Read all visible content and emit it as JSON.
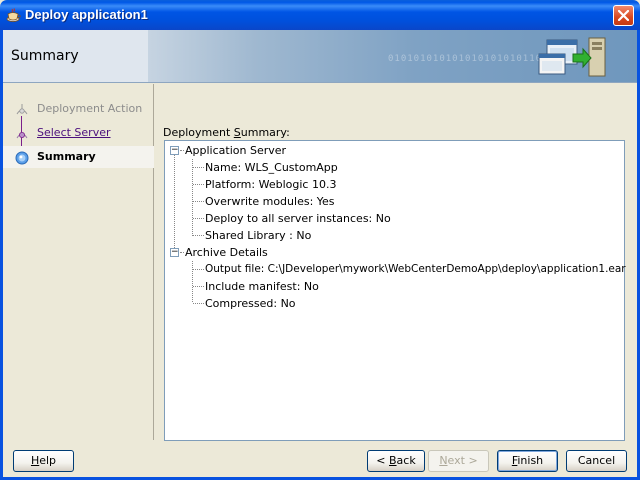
{
  "window": {
    "title": "Deploy application1"
  },
  "header": {
    "title": "Summary",
    "binary_pattern": "0101010101010101010101101010101"
  },
  "nav": {
    "items": [
      {
        "label": "Deployment Action",
        "state": "disabled"
      },
      {
        "label": "Select Server",
        "state": "link"
      },
      {
        "label": "Summary",
        "state": "active"
      }
    ]
  },
  "summary": {
    "section_label_pre": "Deployment ",
    "section_label_accel": "S",
    "section_label_post": "ummary:",
    "groups": [
      {
        "label": "Application Server",
        "expander": "−",
        "items": [
          "Name:  WLS_CustomApp",
          "Platform: Weblogic 10.3",
          "Overwrite modules: Yes",
          "Deploy to all server instances: No",
          "Shared Library : No"
        ]
      },
      {
        "label": "Archive Details",
        "expander": "−",
        "items": [
          "Output file: C:\\JDeveloper\\mywork\\WebCenterDemoApp\\deploy\\application1.ear",
          "Include manifest: No",
          "Compressed: No"
        ]
      }
    ]
  },
  "buttons": {
    "help": "Help",
    "back": "< Back",
    "next": "Next >",
    "finish": "Finish",
    "cancel": "Cancel"
  },
  "colors": {
    "titlebar": "#0058e6",
    "link": "#4b0f7d",
    "close": "#d9481f"
  }
}
